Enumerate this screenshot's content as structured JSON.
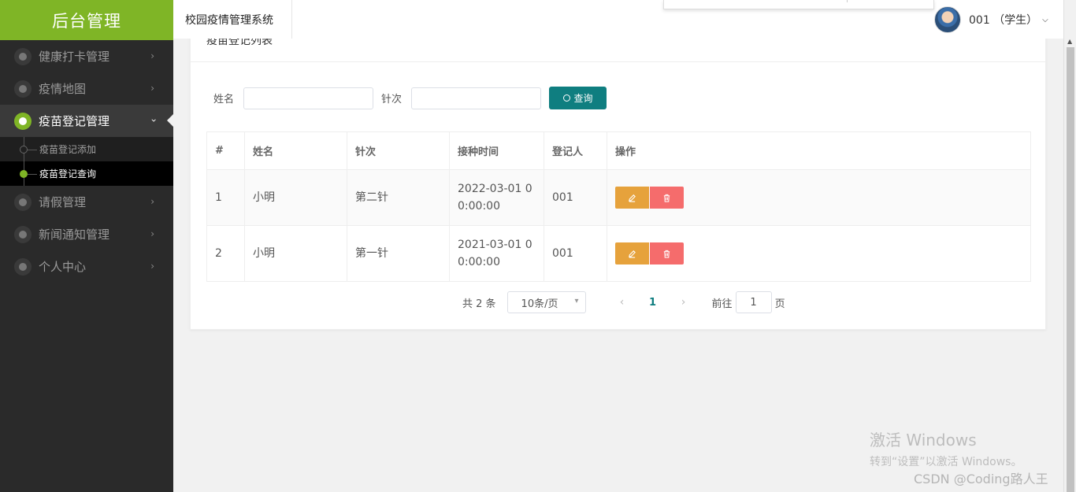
{
  "sidebar": {
    "logo": "后台管理",
    "items": [
      {
        "label": "健康打卡管理",
        "chevron": "›"
      },
      {
        "label": "疫情地图",
        "chevron": "›"
      },
      {
        "label": "疫苗登记管理",
        "chevron": "›"
      },
      {
        "label": "请假管理",
        "chevron": "›"
      },
      {
        "label": "新闻通知管理",
        "chevron": "›"
      },
      {
        "label": "个人中心",
        "chevron": "›"
      }
    ],
    "sub_items": [
      {
        "label": "疫苗登记添加"
      },
      {
        "label": "疫苗登记查询"
      }
    ]
  },
  "header": {
    "tab_label": "校园疫情管理系统",
    "user": "001 （学生）"
  },
  "card": {
    "title": "疫苗登记列表",
    "search": {
      "name_label": "姓名",
      "dose_label": "针次",
      "query_label": "查询"
    },
    "table": {
      "headers": [
        "#",
        "姓名",
        "针次",
        "接种时间",
        "登记人",
        "操作"
      ],
      "rows": [
        {
          "index": "1",
          "name": "小明",
          "dose": "第二针",
          "time": "2022-03-01 00:00:00",
          "registrar": "001"
        },
        {
          "index": "2",
          "name": "小明",
          "dose": "第一针",
          "time": "2021-03-01 00:00:00",
          "registrar": "001"
        }
      ]
    },
    "pagination": {
      "total": "共 2 条",
      "page_size": "10条/页",
      "prev": "‹",
      "current": "1",
      "next": "›",
      "goto_prefix": "前往",
      "goto_value": "1",
      "goto_suffix": "页"
    }
  },
  "watermark": {
    "line1": "激活 Windows",
    "line2": "转到“设置”以激活 Windows。",
    "credit": "CSDN @Coding路人王"
  },
  "colors": {
    "brand": "#7fb526",
    "primary": "#0f7e80",
    "edit": "#e6a23c",
    "delete": "#f56c6c"
  }
}
